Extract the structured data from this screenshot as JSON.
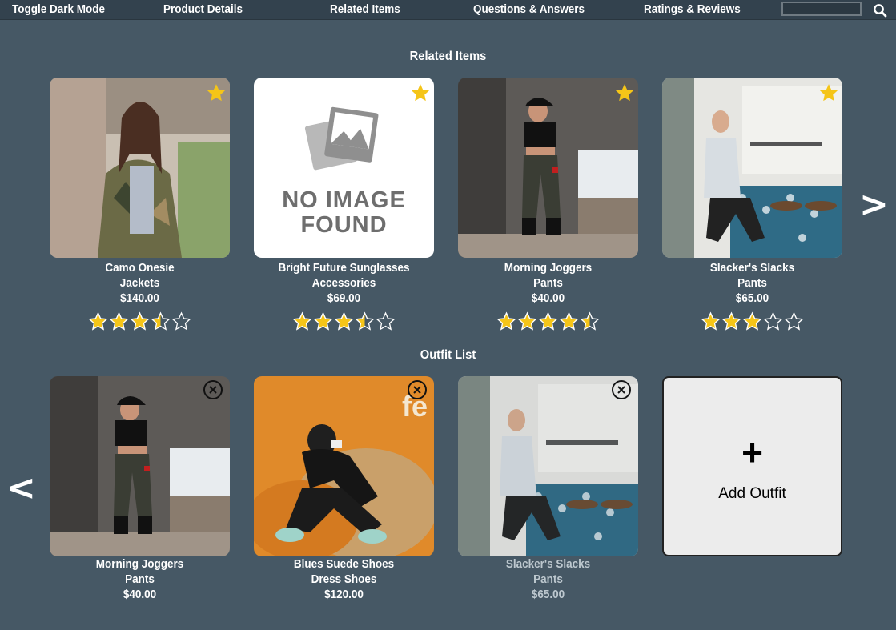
{
  "nav": {
    "items": [
      "Toggle Dark Mode",
      "Product Details",
      "Related Items",
      "Questions & Answers",
      "Ratings & Reviews"
    ],
    "search_value": "",
    "search_icon": "search-icon"
  },
  "related": {
    "title": "Related Items",
    "items": [
      {
        "name": "Camo Onesie",
        "category": "Jackets",
        "price": "$140.00",
        "rating": 3.5
      },
      {
        "name": "Bright Future Sunglasses",
        "category": "Accessories",
        "price": "$69.00",
        "rating": 3.5,
        "no_image_text": [
          "NO IMAGE",
          "FOUND"
        ]
      },
      {
        "name": "Morning Joggers",
        "category": "Pants",
        "price": "$40.00",
        "rating": 4.5
      },
      {
        "name": "Slacker's Slacks",
        "category": "Pants",
        "price": "$65.00",
        "rating": 3
      }
    ],
    "next_arrow": ">"
  },
  "outfit": {
    "title": "Outfit List",
    "items": [
      {
        "name": "Morning Joggers",
        "category": "Pants",
        "price": "$40.00"
      },
      {
        "name": "Blues Suede Shoes",
        "category": "Dress Shoes",
        "price": "$120.00",
        "photo_text": "fe"
      },
      {
        "name": "Slacker's Slacks",
        "category": "Pants",
        "price": "$65.00"
      }
    ],
    "prev_arrow": "<",
    "add_plus": "+",
    "add_label": "Add Outfit"
  },
  "colors": {
    "background": "#465865",
    "navbar": "#33424e",
    "star": "#f5c518"
  }
}
